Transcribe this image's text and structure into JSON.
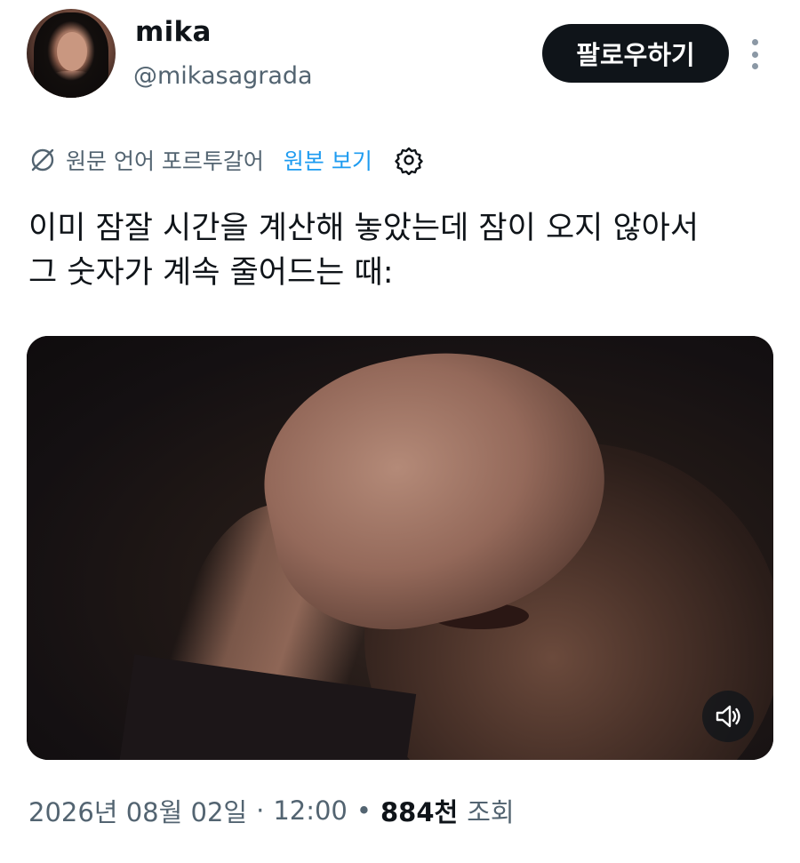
{
  "header": {
    "display_name": "mika",
    "handle": "@mikasagrada",
    "follow_label": "팔로우하기",
    "avatar_icon": "profile-photo",
    "more_icon": "vertical-dots-icon"
  },
  "translation": {
    "label": "원문 언어 포르투갈어",
    "show_original": "원본 보기",
    "globe_icon": "translate-icon",
    "settings_icon": "gear-icon"
  },
  "tweet": {
    "text_line1": "이미 잠잘 시간을 계산해 놓았는데 잠이 오지 않아서",
    "text_line2": "그 숫자가 계속 줄어드는 때:"
  },
  "media": {
    "mute_icon": "speaker-muted-icon"
  },
  "meta": {
    "date": "2026년 08월 02일",
    "time": "12:00",
    "separator_dot": "·",
    "bullet": "•",
    "views_count": "884천",
    "views_label": "조회"
  },
  "colors": {
    "text_primary": "#0f1419",
    "text_secondary": "#536471",
    "link": "#1d9bf0",
    "button_bg": "#0f1419"
  }
}
